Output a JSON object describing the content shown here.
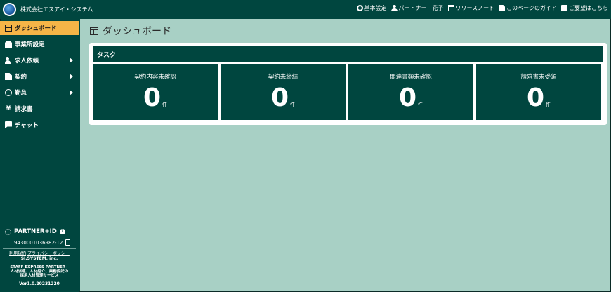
{
  "header": {
    "company": "株式会社エスアイ・システム",
    "nav": [
      {
        "icon": "gear-icon",
        "label": "基本設定"
      },
      {
        "icon": "user-icon",
        "label": "パートナー　花子"
      },
      {
        "icon": "calendar-icon",
        "label": "リリースノート"
      },
      {
        "icon": "document-icon",
        "label": "このページのガイド"
      },
      {
        "icon": "chat-icon",
        "label": "ご要望はこちら"
      }
    ]
  },
  "sidebar": {
    "items": [
      {
        "label": "ダッシュボード",
        "icon": "dashboard-icon",
        "active": true
      },
      {
        "label": "事業所設定",
        "icon": "building-icon"
      },
      {
        "label": "求人依頼",
        "icon": "people-icon",
        "has_submenu": true
      },
      {
        "label": "契約",
        "icon": "document-icon",
        "has_submenu": true
      },
      {
        "label": "勤怠",
        "icon": "clock-icon",
        "has_submenu": true
      },
      {
        "label": "請求書",
        "icon": "yen-icon"
      },
      {
        "label": "チャット",
        "icon": "chat-icon"
      }
    ],
    "partner_id_label": "PARTNER+ID",
    "partner_id_value": "9430001036982-12",
    "links": {
      "terms": "利用規約",
      "privacy": "プライバシーポリシー"
    },
    "company_en": "SI.SYSTEM, inc.",
    "tagline_1": "STAFF EXPRESS PARTNER+",
    "tagline_2": "人材派遣、人材紹介、業務委託の",
    "tagline_3": "採用人材管理サービス",
    "version": "Ver1.0.20231220"
  },
  "main": {
    "title": "ダッシュボード",
    "panel_title": "タスク",
    "tiles": [
      {
        "label": "契約内容未確認",
        "value": "0",
        "unit": "件"
      },
      {
        "label": "契約未締結",
        "value": "0",
        "unit": "件"
      },
      {
        "label": "関連書類未確認",
        "value": "0",
        "unit": "件"
      },
      {
        "label": "請求書未受領",
        "value": "0",
        "unit": "件"
      }
    ]
  },
  "colors": {
    "primary": "#00463f",
    "accent": "#f5b547",
    "background": "#a8d0c5"
  }
}
